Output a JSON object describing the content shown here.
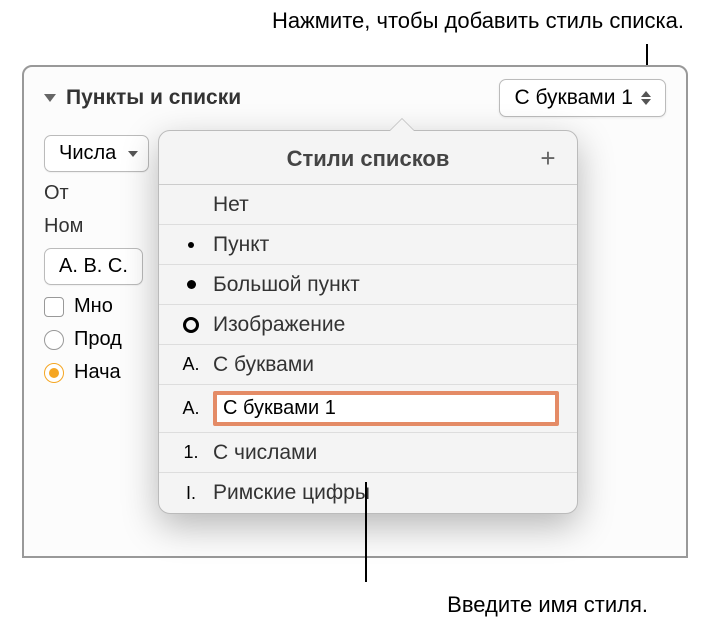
{
  "callouts": {
    "top": "Нажмите, чтобы добавить стиль списка.",
    "bottom": "Введите имя стиля."
  },
  "section": {
    "title": "Пункты и списки",
    "selected_style": "С буквами 1"
  },
  "bg": {
    "numbers_label": "Числа",
    "indent_label": "От",
    "number_label": "Ном",
    "example": "A. B. C.",
    "multi_label": "Мно",
    "continue_label": "Прод",
    "start_label": "Нача"
  },
  "popover": {
    "title": "Стили списков",
    "add": "+",
    "items": [
      {
        "marker": "",
        "label": "Нет"
      },
      {
        "marker": "dot",
        "label": "Пункт"
      },
      {
        "marker": "bigdot",
        "label": "Большой пункт"
      },
      {
        "marker": "ring",
        "label": "Изображение"
      },
      {
        "marker": "A.",
        "label": "С буквами"
      },
      {
        "marker": "A.",
        "label": "С буквами 1",
        "editing": true
      },
      {
        "marker": "1.",
        "label": "С числами"
      },
      {
        "marker": "I.",
        "label": "Римские цифры"
      }
    ]
  }
}
